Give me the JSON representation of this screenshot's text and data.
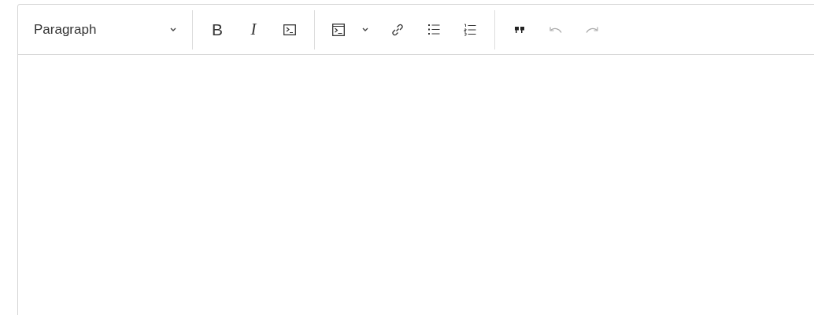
{
  "toolbar": {
    "format": {
      "value": "Paragraph"
    },
    "bold": {
      "label": "B"
    },
    "italic": {
      "label": "I"
    },
    "undo": {
      "disabled": true
    },
    "redo": {
      "disabled": true
    }
  }
}
